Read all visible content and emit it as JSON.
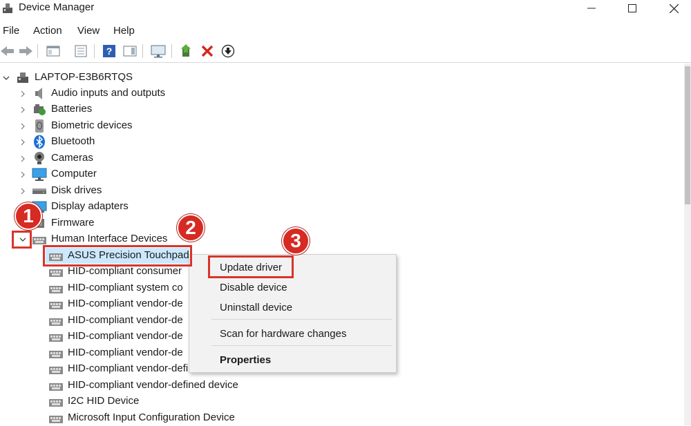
{
  "window": {
    "title": "Device Manager"
  },
  "menu": [
    "File",
    "Action",
    "View",
    "Help"
  ],
  "tree": {
    "root": "LAPTOP-E3B6RTQS",
    "categories": [
      "Audio inputs and outputs",
      "Batteries",
      "Biometric devices",
      "Bluetooth",
      "Cameras",
      "Computer",
      "Disk drives",
      "Display adapters",
      "Firmware",
      "Human Interface Devices"
    ],
    "hid_children": [
      "ASUS Precision Touchpad",
      "HID-compliant consumer",
      "HID-compliant system co",
      "HID-compliant vendor-de",
      "HID-compliant vendor-de",
      "HID-compliant vendor-de",
      "HID-compliant vendor-de",
      "HID-compliant vendor-defined device",
      "HID-compliant vendor-defined device",
      "I2C HID Device",
      "Microsoft Input Configuration Device"
    ]
  },
  "context_menu": {
    "update": "Update driver",
    "disable": "Disable device",
    "uninstall": "Uninstall device",
    "scan": "Scan for hardware changes",
    "properties": "Properties"
  },
  "annotations": {
    "step1": "1",
    "step2": "2",
    "step3": "3"
  },
  "colors": {
    "annotation_red": "#d62a22",
    "selection": "#cce8ff"
  }
}
